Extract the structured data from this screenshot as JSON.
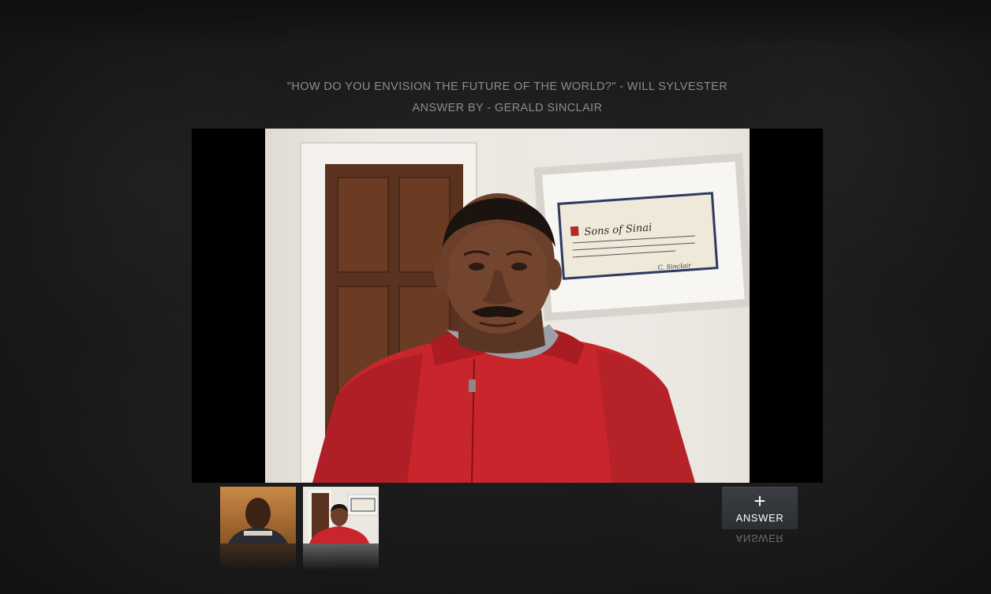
{
  "header": {
    "question": "\"HOW DO YOU ENVISION THE FUTURE OF THE WORLD?\" - WILL SYLVESTER",
    "answer_by": "ANSWER BY - GERALD SINCLAIR"
  },
  "player": {
    "frame_text": {
      "title": "Sons of Sinai",
      "signature": "C. Sinclair"
    }
  },
  "thumbnails": [
    {
      "name": "answer-thumbnail-1"
    },
    {
      "name": "answer-thumbnail-2"
    }
  ],
  "answer_button": {
    "icon": "plus-icon",
    "glyph": "+",
    "label": "ANSWER"
  },
  "colors": {
    "background": "#1c1c1c",
    "text": "#8c8c8c",
    "button": "#33363a",
    "jacket": "#c8262c"
  }
}
